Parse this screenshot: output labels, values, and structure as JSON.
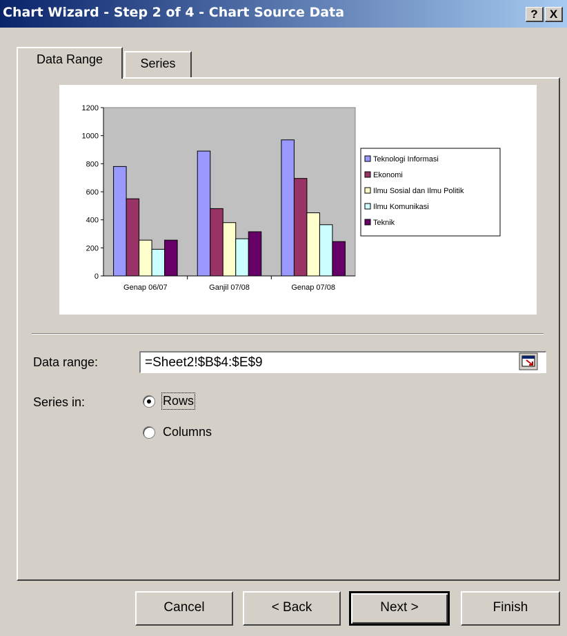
{
  "window": {
    "title": "Chart Wizard - Step 2 of 4 - Chart Source Data",
    "help_label": "?",
    "close_label": "X"
  },
  "tabs": [
    {
      "label": "Data Range"
    },
    {
      "label": "Series"
    }
  ],
  "form": {
    "data_range_label": "Data range:",
    "data_range_value": "=Sheet2!$B$4:$E$9",
    "series_in_label": "Series in:",
    "rows_label": "Rows",
    "columns_label": "Columns",
    "series_in_selected": "Rows"
  },
  "buttons": {
    "cancel": "Cancel",
    "back": "< Back",
    "next": "Next >",
    "finish": "Finish"
  },
  "chart_data": {
    "type": "bar",
    "categories": [
      "Genap 06/07",
      "Ganjil 07/08",
      "Genap 07/08"
    ],
    "ylim": [
      0,
      1200
    ],
    "yticks": [
      "0",
      "200",
      "400",
      "600",
      "800",
      "1000",
      "1200"
    ],
    "grid": false,
    "legend_position": "right",
    "plot_background": "#c0c0c0",
    "series": [
      {
        "name": "Teknologi Informasi",
        "color": "#9999ff",
        "values": [
          780,
          890,
          970
        ]
      },
      {
        "name": "Ekonomi",
        "color": "#993366",
        "values": [
          550,
          480,
          695
        ]
      },
      {
        "name": "Ilmu Sosial dan Ilmu Politik",
        "color": "#ffffcc",
        "values": [
          255,
          380,
          450
        ]
      },
      {
        "name": "Ilmu Komunikasi",
        "color": "#ccffff",
        "values": [
          190,
          265,
          365
        ]
      },
      {
        "name": "Teknik",
        "color": "#660066",
        "values": [
          255,
          315,
          245
        ]
      }
    ]
  }
}
